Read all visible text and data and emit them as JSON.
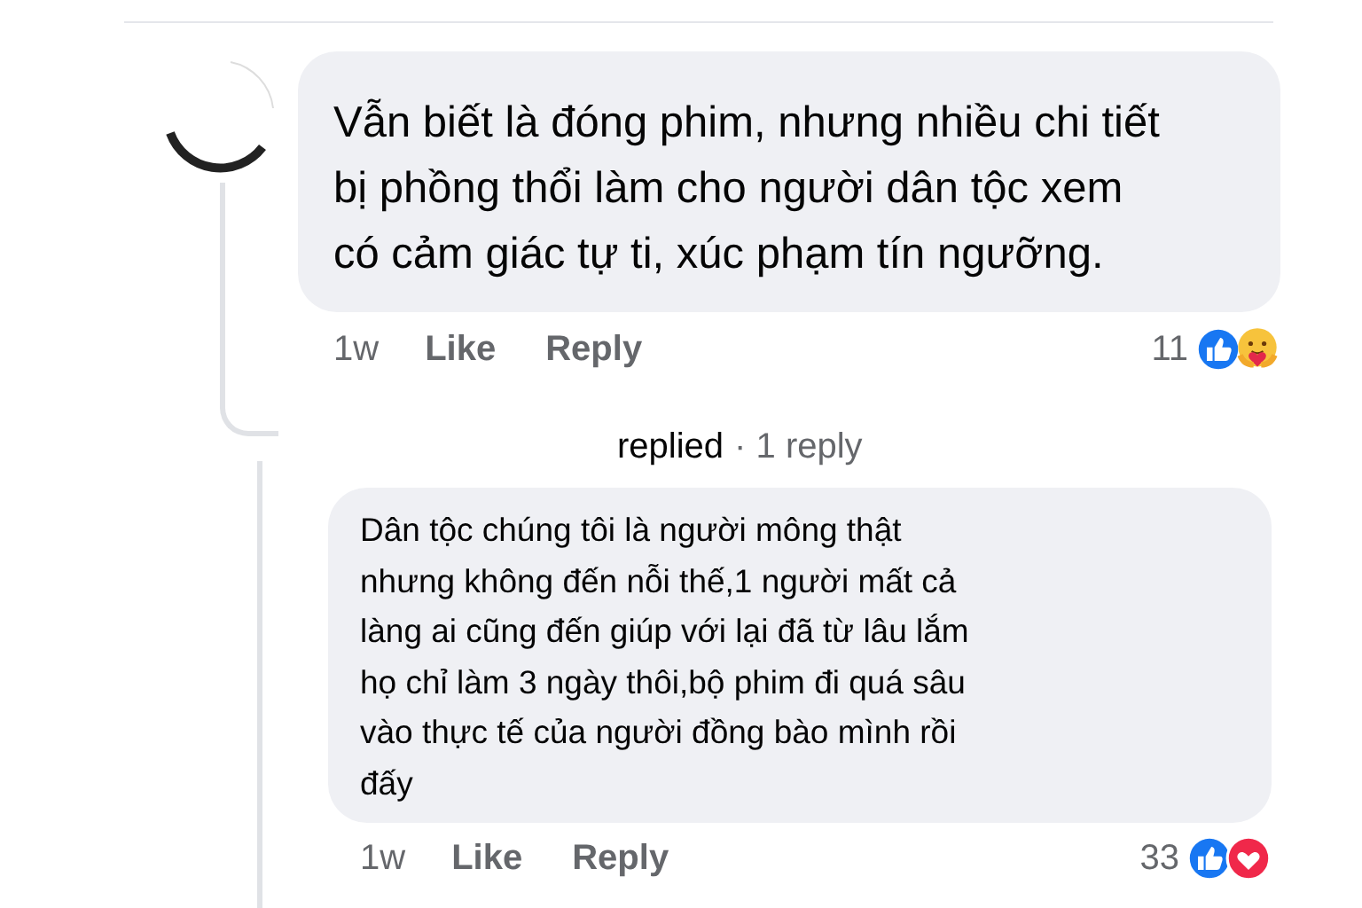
{
  "comment": {
    "text": "Vẫn biết là đóng phim, nhưng nhiều chi tiết\nbị phồng thổi làm cho người dân tộc xem\ncó cảm giác tự ti, xúc phạm tín ngưỡng.",
    "time": "1w",
    "actions": [
      "Like",
      "Reply"
    ],
    "reaction_count": "11",
    "reactions": [
      {
        "kind": "like"
      },
      {
        "kind": "care"
      }
    ]
  },
  "reply_summary": {
    "action": "replied",
    "count": "· 1 reply"
  },
  "reply": {
    "text": "Dân tộc chúng tôi là người mông thật\nnhưng không đến nỗi thế,1 người mất cả\nlàng ai cũng đến giúp với lại đã từ lâu lắm\nhọ chỉ làm 3 ngày thôi,bộ phim đi quá sâu\nvào thực tế của người đồng bào mình rồi\nđấy",
    "time": "1w",
    "actions": [
      "Like",
      "Reply"
    ],
    "reaction_count": "33",
    "reactions": [
      {
        "kind": "like"
      },
      {
        "kind": "love"
      }
    ]
  }
}
